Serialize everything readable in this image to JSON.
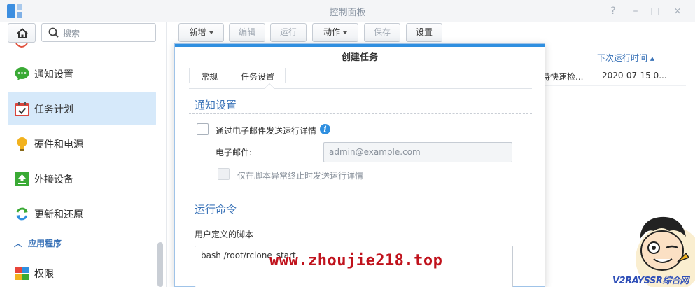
{
  "window": {
    "title": "控制面板",
    "controls": [
      "?",
      "–",
      "□",
      "×"
    ]
  },
  "sidebar": {
    "search_placeholder": "搜索",
    "items": [
      {
        "label": "通知设置",
        "icon": "chat-bubble-icon",
        "active": false
      },
      {
        "label": "任务计划",
        "icon": "calendar-check-icon",
        "active": true
      },
      {
        "label": "硬件和电源",
        "icon": "lightbulb-icon",
        "active": false
      },
      {
        "label": "外接设备",
        "icon": "upload-box-icon",
        "active": false
      },
      {
        "label": "更新和还原",
        "icon": "refresh-icon",
        "active": false
      }
    ],
    "section_label": "应用程序",
    "section_items": [
      {
        "label": "权限",
        "icon": "windows-grid-icon"
      }
    ]
  },
  "toolbar": {
    "create": "新增",
    "edit": "编辑",
    "run": "运行",
    "action": "动作",
    "save": "保存",
    "settings": "设置"
  },
  "table": {
    "header": "下次运行时间",
    "row": {
      "task": "持快速检...",
      "next_run": "2020-07-15 0..."
    }
  },
  "dialog": {
    "title": "创建任务",
    "tabs": [
      "常规",
      "任务设置"
    ],
    "active_tab": "任务设置",
    "notify_section": "通知设置",
    "email_checkbox_label": "通过电子邮件发送运行详情",
    "email_label": "电子邮件:",
    "email_placeholder": "admin@example.com",
    "abnormal_only_label": "仅在脚本异常终止时发送运行详情",
    "command_section": "运行命令",
    "script_label": "用户定义的脚本",
    "script_value": "bash /root/rclone_start"
  },
  "watermark": {
    "url": "www.zhoujie218.top",
    "badge": "V2RAYSSR综合网"
  },
  "colors": {
    "accent": "#2f8fe0",
    "section_title": "#3a73b8",
    "active_nav": "#d6e9fa",
    "watermark": "#c0121c"
  }
}
